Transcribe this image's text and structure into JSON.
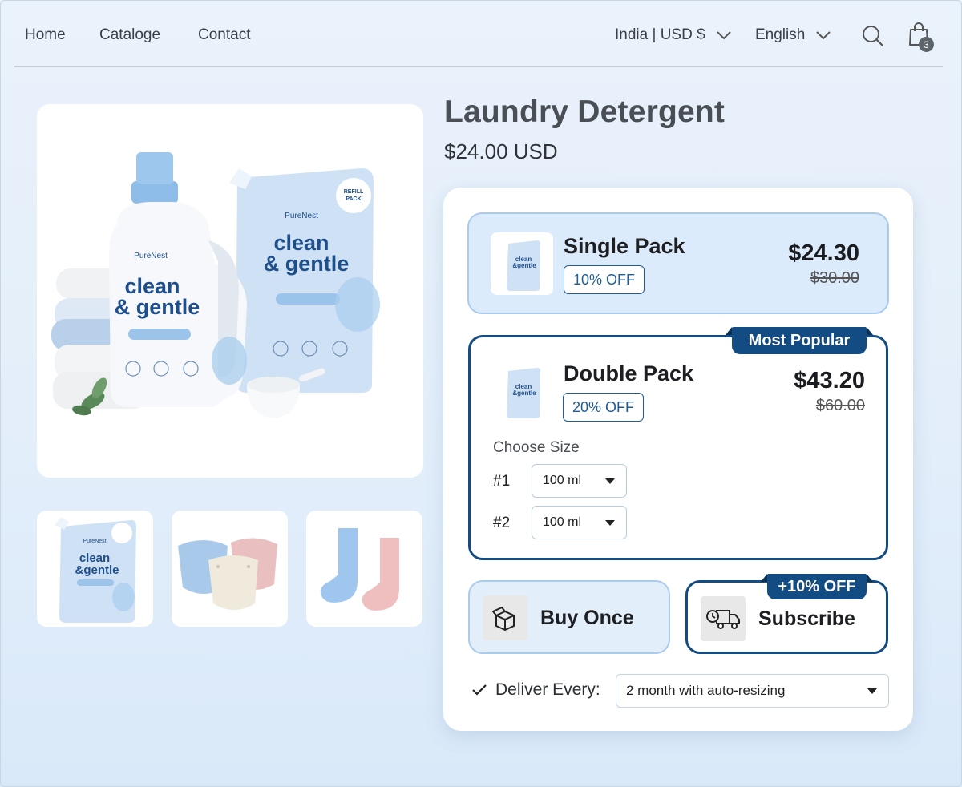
{
  "nav": {
    "links": [
      "Home",
      "Cataloge",
      "Contact"
    ],
    "region": "India | USD $",
    "language": "English",
    "cart_count": "3"
  },
  "product": {
    "title": "Laundry Detergent",
    "price": "$24.00 USD",
    "image_brand": "PureNest",
    "image_tagline_1": "clean",
    "image_tagline_2": "& gentle"
  },
  "packs": [
    {
      "name": "Single Pack",
      "discount": "10% OFF",
      "price": "$24.30",
      "old_price": "$30.00"
    },
    {
      "name": "Double Pack",
      "discount": "20% OFF",
      "price": "$43.20",
      "old_price": "$60.00",
      "badge": "Most Popular",
      "choose_size_label": "Choose Size",
      "sizes": [
        {
          "label": "#1",
          "value": "100 ml"
        },
        {
          "label": "#2",
          "value": "100 ml"
        }
      ]
    }
  ],
  "purchase": {
    "buy_once": "Buy Once",
    "subscribe": "Subscribe",
    "subscribe_badge": "+10% OFF",
    "deliver_label": "Deliver Every:",
    "deliver_value": "2 month with auto-resizing"
  },
  "colors": {
    "accent": "#134b83",
    "selected_bg": "#dcebfb",
    "selected_border": "#a9cbee"
  }
}
